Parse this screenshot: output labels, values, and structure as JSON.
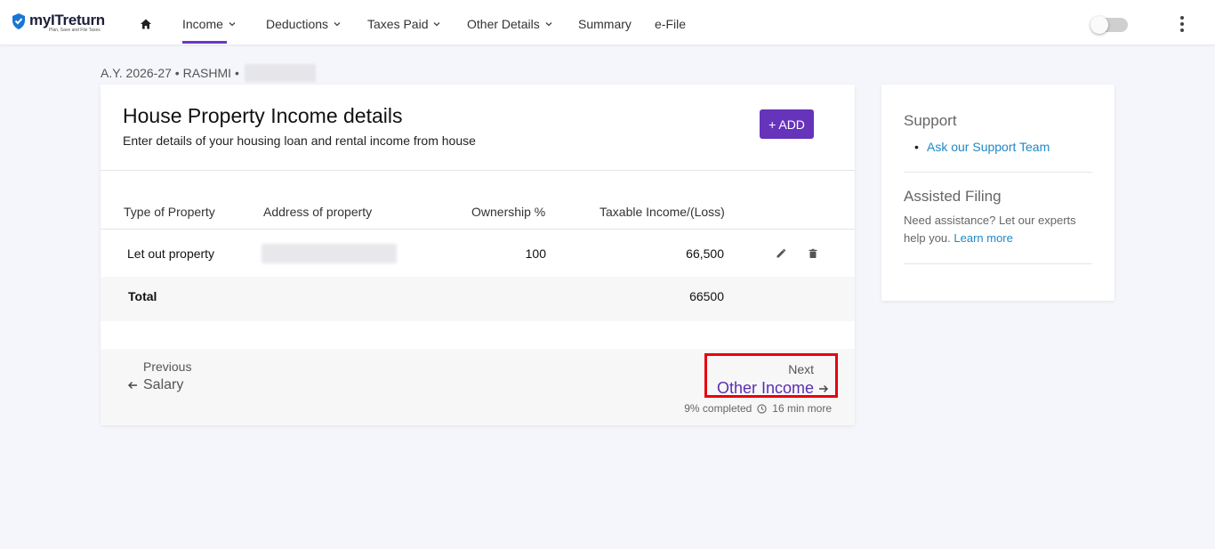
{
  "brand": {
    "name": "myITreturn",
    "tagline": "Plan, Save and File Taxes",
    "color": "#1976d2"
  },
  "nav": {
    "items": [
      {
        "label": "Income",
        "has_dropdown": true,
        "active": true
      },
      {
        "label": "Deductions",
        "has_dropdown": true
      },
      {
        "label": "Taxes Paid",
        "has_dropdown": true
      },
      {
        "label": "Other Details",
        "has_dropdown": true
      },
      {
        "label": "Summary",
        "has_dropdown": false
      },
      {
        "label": "e-File",
        "has_dropdown": false
      }
    ],
    "toggle_on": false,
    "accent": "#6b35c5"
  },
  "breadcrumb": {
    "text": "A.Y. 2026-27 • RASHMI •"
  },
  "card": {
    "title": "House Property Income details",
    "subtitle": "Enter details of your housing loan and rental income from house",
    "add_label": "+ ADD",
    "table": {
      "headers": [
        "Type of Property",
        "Address of property",
        "Ownership %",
        "Taxable Income/(Loss)"
      ],
      "rows": [
        {
          "type": "Let out property",
          "ownership": "100",
          "taxable_income": "66,500"
        }
      ],
      "total_label": "Total",
      "total_value": "66500"
    }
  },
  "footer_nav": {
    "previous_small": "Previous",
    "previous_label": "Salary",
    "next_small": "Next",
    "next_label": "Other Income",
    "progress_text": "9% completed",
    "time_text": "16 min more"
  },
  "side": {
    "support_title": "Support",
    "support_link": "Ask our Support Team",
    "assisted_title": "Assisted Filing",
    "assisted_text": "Need assistance? Let our experts help you.",
    "assisted_link": "Learn more"
  }
}
